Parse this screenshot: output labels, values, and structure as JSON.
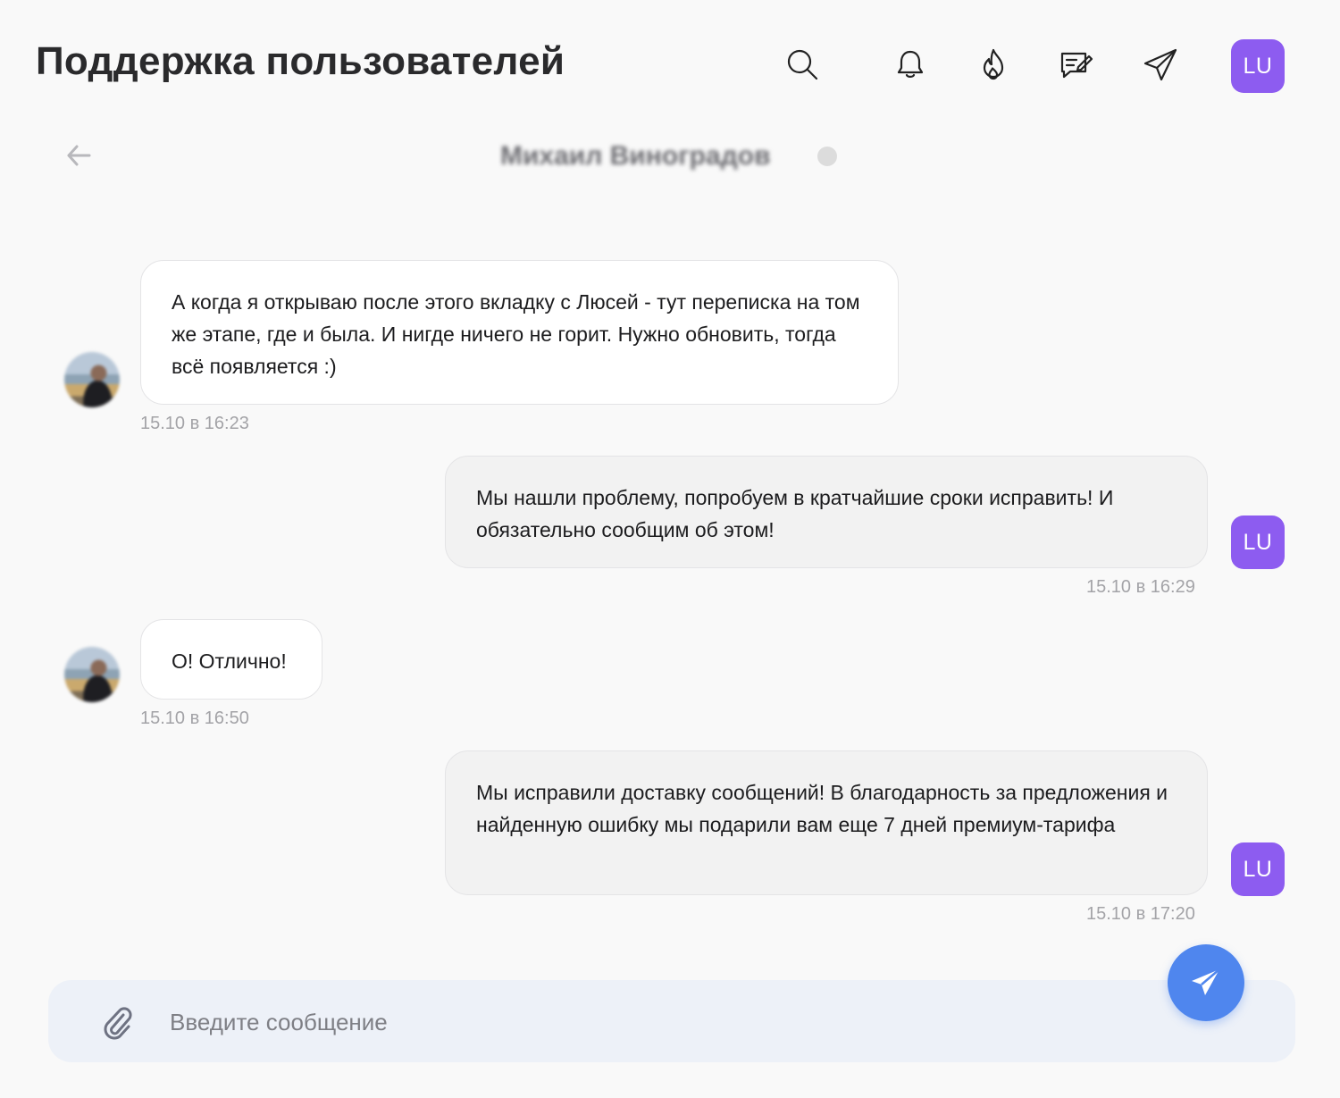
{
  "header": {
    "title": "Поддержка пользователей",
    "icons": [
      "search-icon",
      "bell-icon",
      "fire-icon",
      "chat-edit-icon",
      "paper-plane-icon"
    ],
    "user_avatar": "LU"
  },
  "chat": {
    "contact_name": "Михаил Виноградов",
    "status": "offline"
  },
  "messages": [
    {
      "direction": "incoming",
      "text": "А когда я открываю после этого вкладку с Люсей - тут переписка на том же этапе, где и была. И нигде ничего не горит. Нужно обновить, тогда всё появляется :)",
      "time": "15.10 в 16:23"
    },
    {
      "direction": "outgoing",
      "text": "Мы нашли проблему, попробуем в кратчайшие сроки исправить! И обязательно сообщим об этом!",
      "time": "15.10 в 16:29",
      "avatar": "LU"
    },
    {
      "direction": "incoming",
      "text": "О! Отлично!",
      "time": "15.10 в 16:50"
    },
    {
      "direction": "outgoing",
      "text": "Мы исправили доставку сообщений! В благодарность за предложения и найденную ошибку мы подарили вам еще 7 дней премиум-тарифа",
      "time": "15.10 в 17:20",
      "avatar": "LU"
    }
  ],
  "composer": {
    "placeholder": "Введите сообщение",
    "value": ""
  },
  "colors": {
    "accent_purple": "#8d5cf0",
    "send_blue": "#4f86ee",
    "composer_bg": "#edf1f8",
    "page_bg": "#f9f9f9"
  }
}
